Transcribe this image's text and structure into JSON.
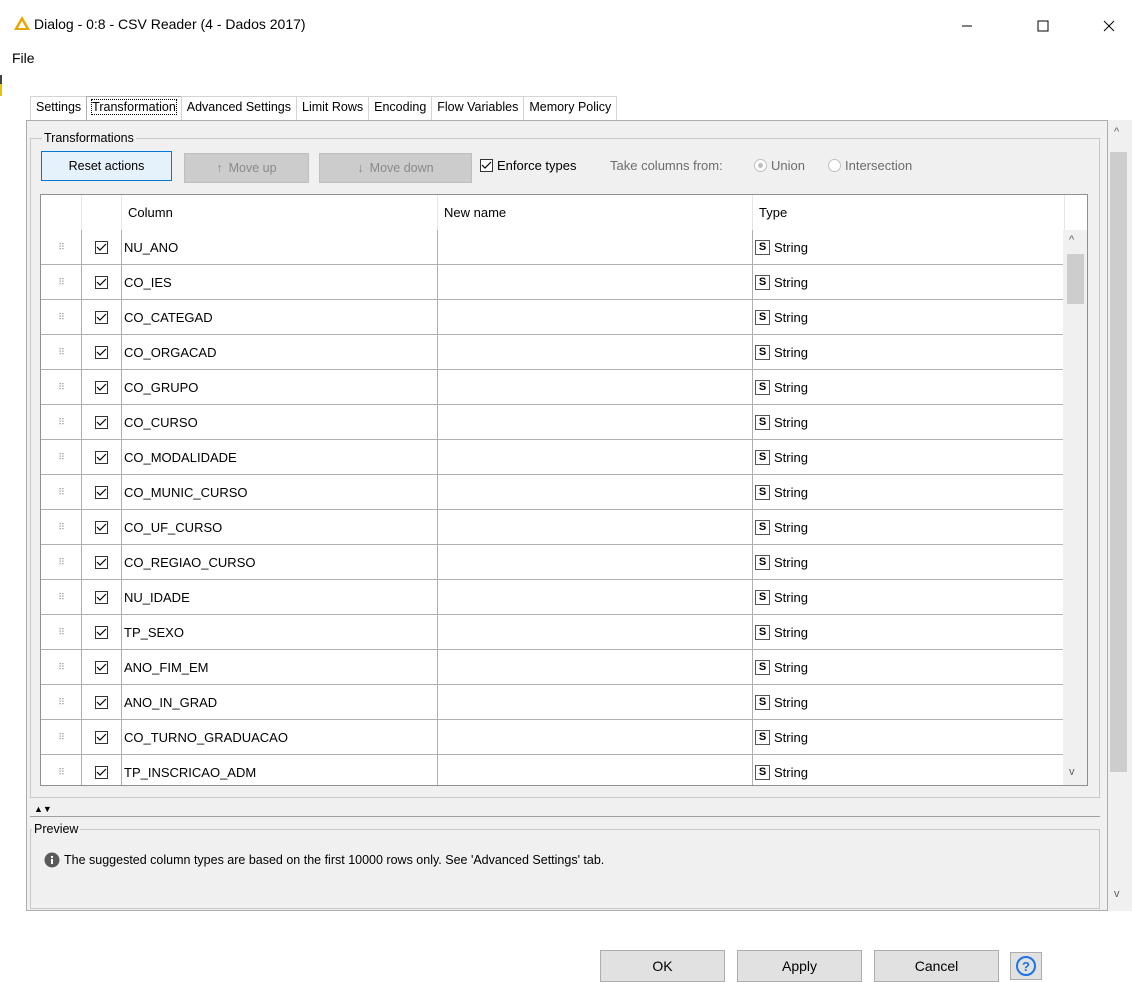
{
  "window": {
    "title": "Dialog - 0:8 - CSV Reader (4 - Dados 2017)",
    "accent": "#e8a700"
  },
  "menu": {
    "file": "File"
  },
  "tabs": [
    {
      "label": "Settings"
    },
    {
      "label": "Transformation"
    },
    {
      "label": "Advanced Settings"
    },
    {
      "label": "Limit Rows"
    },
    {
      "label": "Encoding"
    },
    {
      "label": "Flow Variables"
    },
    {
      "label": "Memory Policy"
    }
  ],
  "transformations": {
    "group_label": "Transformations",
    "reset_label": "Reset actions",
    "move_up_label": "Move up",
    "move_down_label": "Move down",
    "enforce_types_label": "Enforce types",
    "take_columns_label": "Take columns from:",
    "union_label": "Union",
    "intersection_label": "Intersection"
  },
  "table": {
    "headers": {
      "column": "Column",
      "new_name": "New name",
      "type": "Type"
    },
    "rows": [
      {
        "column": "NU_ANO",
        "new_name": "",
        "type": "String",
        "badge": "S"
      },
      {
        "column": "CO_IES",
        "new_name": "",
        "type": "String",
        "badge": "S"
      },
      {
        "column": "CO_CATEGAD",
        "new_name": "",
        "type": "String",
        "badge": "S"
      },
      {
        "column": "CO_ORGACAD",
        "new_name": "",
        "type": "String",
        "badge": "S"
      },
      {
        "column": "CO_GRUPO",
        "new_name": "",
        "type": "String",
        "badge": "S"
      },
      {
        "column": "CO_CURSO",
        "new_name": "",
        "type": "String",
        "badge": "S"
      },
      {
        "column": "CO_MODALIDADE",
        "new_name": "",
        "type": "String",
        "badge": "S"
      },
      {
        "column": "CO_MUNIC_CURSO",
        "new_name": "",
        "type": "String",
        "badge": "S"
      },
      {
        "column": "CO_UF_CURSO",
        "new_name": "",
        "type": "String",
        "badge": "S"
      },
      {
        "column": "CO_REGIAO_CURSO",
        "new_name": "",
        "type": "String",
        "badge": "S"
      },
      {
        "column": "NU_IDADE",
        "new_name": "",
        "type": "String",
        "badge": "S"
      },
      {
        "column": "TP_SEXO",
        "new_name": "",
        "type": "String",
        "badge": "S"
      },
      {
        "column": "ANO_FIM_EM",
        "new_name": "",
        "type": "String",
        "badge": "S"
      },
      {
        "column": "ANO_IN_GRAD",
        "new_name": "",
        "type": "String",
        "badge": "S"
      },
      {
        "column": "CO_TURNO_GRADUACAO",
        "new_name": "",
        "type": "String",
        "badge": "S"
      },
      {
        "column": "TP_INSCRICAO_ADM",
        "new_name": "",
        "type": "String",
        "badge": "S"
      }
    ]
  },
  "preview": {
    "label": "Preview",
    "info_text": "The suggested column types are based on the first 10000 rows only. See 'Advanced Settings' tab."
  },
  "buttons": {
    "ok": "OK",
    "apply": "Apply",
    "cancel": "Cancel",
    "help": "?"
  }
}
